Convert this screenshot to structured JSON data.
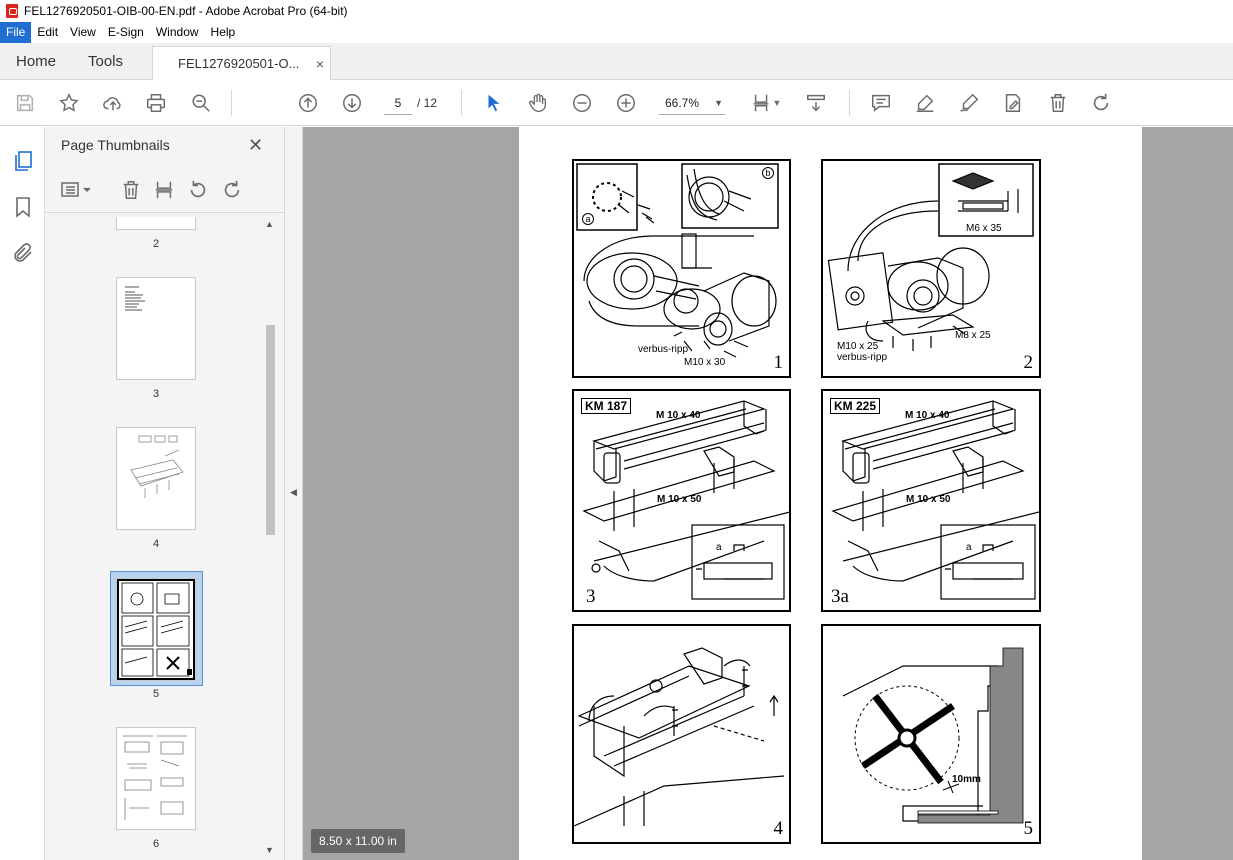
{
  "window": {
    "title": "FEL1276920501-OIB-00-EN.pdf - Adobe Acrobat Pro (64-bit)"
  },
  "menu": [
    "File",
    "Edit",
    "View",
    "E-Sign",
    "Window",
    "Help"
  ],
  "tabs": {
    "home": "Home",
    "tools": "Tools",
    "document": "FEL1276920501-O...",
    "close": "×"
  },
  "toolbar": {
    "page_current": "5",
    "page_total": "/ 12",
    "zoom": "66.7%"
  },
  "panel": {
    "title": "Page Thumbnails",
    "close": "✕",
    "thumbnails": [
      {
        "label": "2"
      },
      {
        "label": "3"
      },
      {
        "label": "4"
      },
      {
        "label": "5",
        "selected": true
      },
      {
        "label": "6"
      }
    ]
  },
  "document": {
    "size_badge": "8.50 x 11.00 in",
    "figures": [
      {
        "number": "1",
        "labels": [
          "verbus-ripp",
          "M10 x 30",
          "a",
          "b"
        ]
      },
      {
        "number": "2",
        "labels": [
          "M6 x 35",
          "M8 x 25",
          "M10 x 25",
          "verbus-ripp"
        ]
      },
      {
        "number": "3",
        "labels": [
          "KM 187",
          "M 10 x 40",
          "M 10 x 50",
          "a"
        ]
      },
      {
        "number": "3a",
        "labels": [
          "KM 225",
          "M 10 x 40",
          "M 10 x 50",
          "a"
        ]
      },
      {
        "number": "4",
        "labels": []
      },
      {
        "number": "5",
        "labels": [
          "10mm"
        ]
      }
    ]
  }
}
